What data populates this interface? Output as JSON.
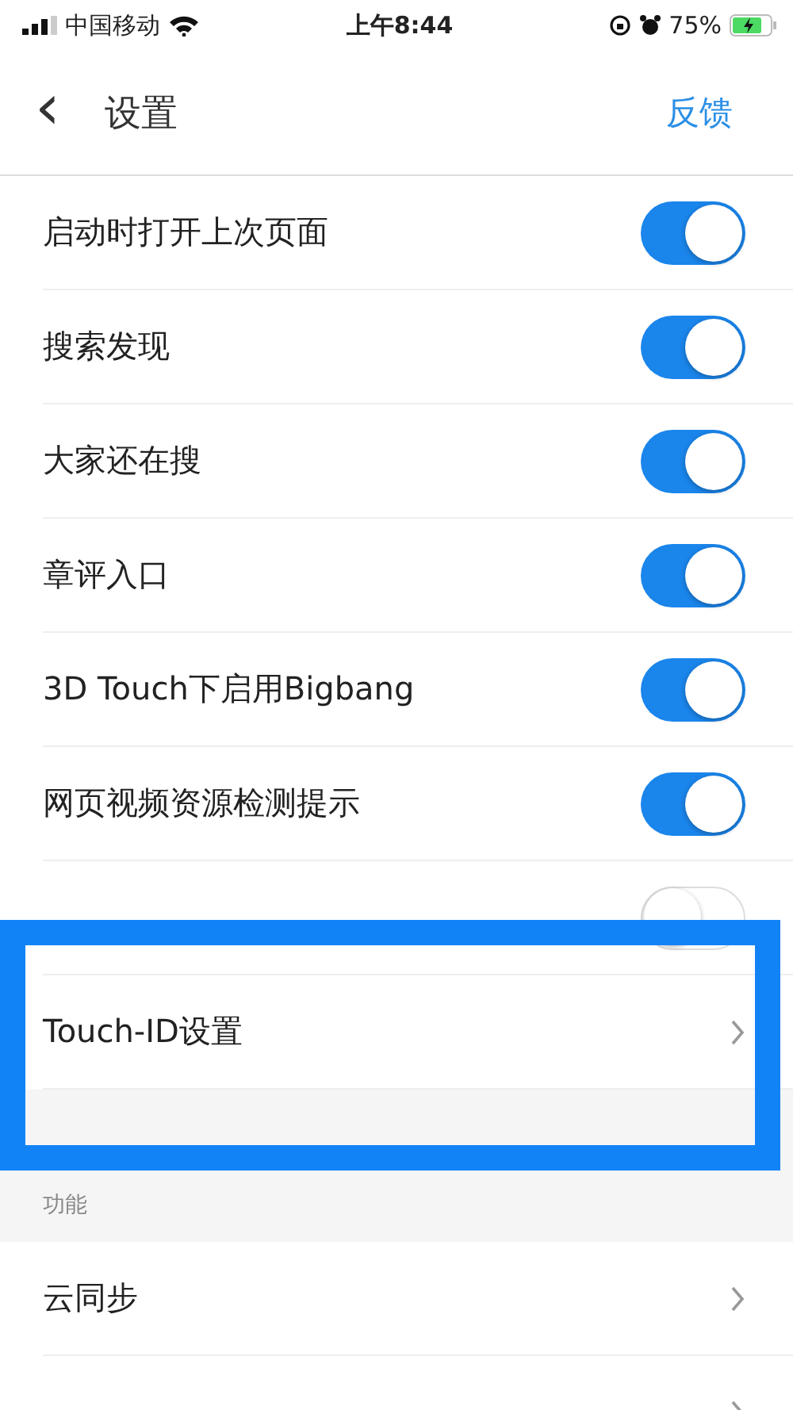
{
  "status_bar": {
    "carrier": "中国移动",
    "time": "上午8:44",
    "battery": "75%"
  },
  "nav": {
    "back": "‹",
    "title": "设置",
    "action": "反馈"
  },
  "groups": [
    {
      "items": [
        {
          "kind": "toggle",
          "label": "启动时打开上次页面",
          "on": true
        },
        {
          "kind": "toggle",
          "label": "搜索发现",
          "on": true
        },
        {
          "kind": "toggle",
          "label": "大家还在搜",
          "on": true
        },
        {
          "kind": "toggle",
          "label": "章评入口",
          "on": true
        },
        {
          "kind": "toggle",
          "label": "3D Touch下启用Bigbang",
          "on": true
        },
        {
          "kind": "toggle",
          "label": "网页视频资源检测提示",
          "on": true
        },
        {
          "kind": "toggle",
          "on": false
        },
        {
          "kind": "link",
          "label": "Touch-ID设置"
        }
      ]
    },
    {
      "header": "功能",
      "items": [
        {
          "kind": "link",
          "label": "云同步"
        },
        {
          "kind": "link"
        }
      ]
    }
  ]
}
